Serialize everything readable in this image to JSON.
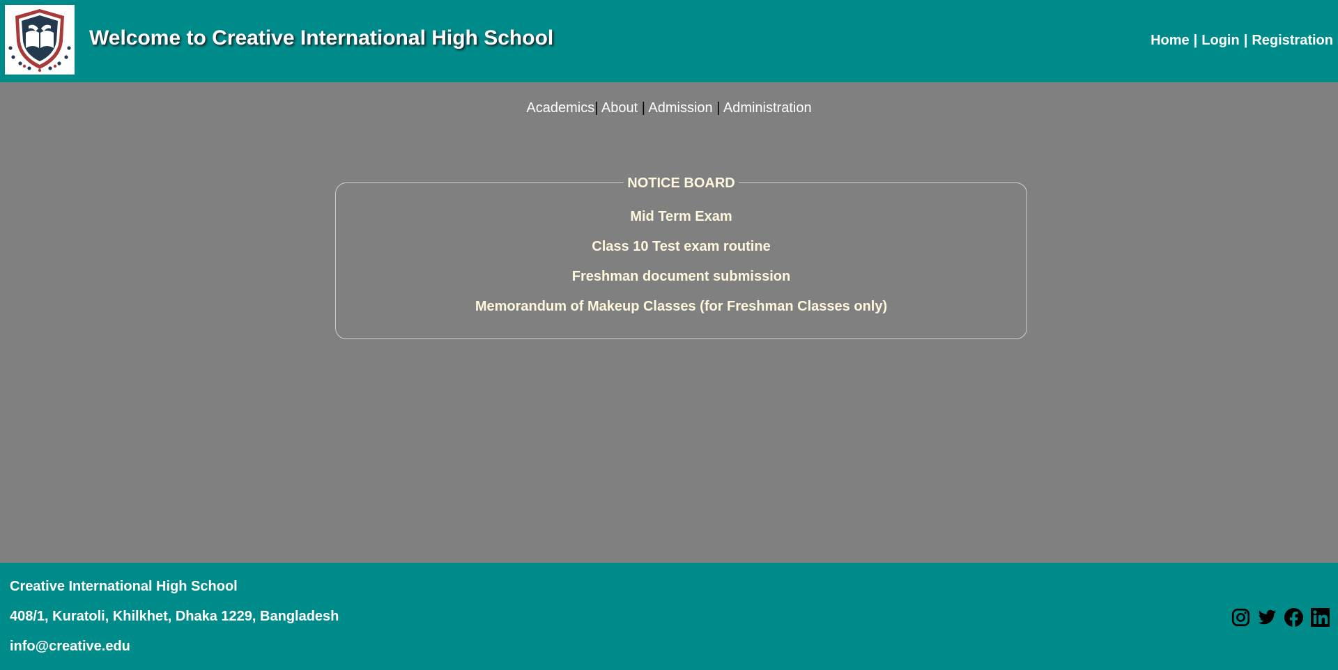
{
  "header": {
    "logo_name": "school-crest-logo",
    "title": "Welcome to Creative International High School",
    "nav": [
      {
        "label": "Home"
      },
      {
        "label": "Login"
      },
      {
        "label": "Registration"
      }
    ],
    "separator": "|"
  },
  "sub_nav": {
    "items": [
      {
        "label": "Academics"
      },
      {
        "label": "About"
      },
      {
        "label": "Admission"
      },
      {
        "label": "Administration"
      }
    ],
    "separator": "|"
  },
  "notice_board": {
    "title": "NOTICE BOARD",
    "items": [
      {
        "label": "Mid Term Exam"
      },
      {
        "label": "Class 10 Test exam routine"
      },
      {
        "label": "Freshman document submission"
      },
      {
        "label": "Memorandum of Makeup Classes (for Freshman Classes only)"
      }
    ]
  },
  "footer": {
    "name": "Creative International High School",
    "address": "408/1, Kuratoli, Khilkhet, Dhaka 1229, Bangladesh",
    "email": "info@creative.edu",
    "social": [
      {
        "icon": "instagram-icon"
      },
      {
        "icon": "twitter-icon"
      },
      {
        "icon": "facebook-icon"
      },
      {
        "icon": "linkedin-icon"
      }
    ]
  },
  "colors": {
    "teal": "#008b8b",
    "background": "#808080",
    "notice_text": "#fff8dc",
    "white": "#ffffff"
  }
}
